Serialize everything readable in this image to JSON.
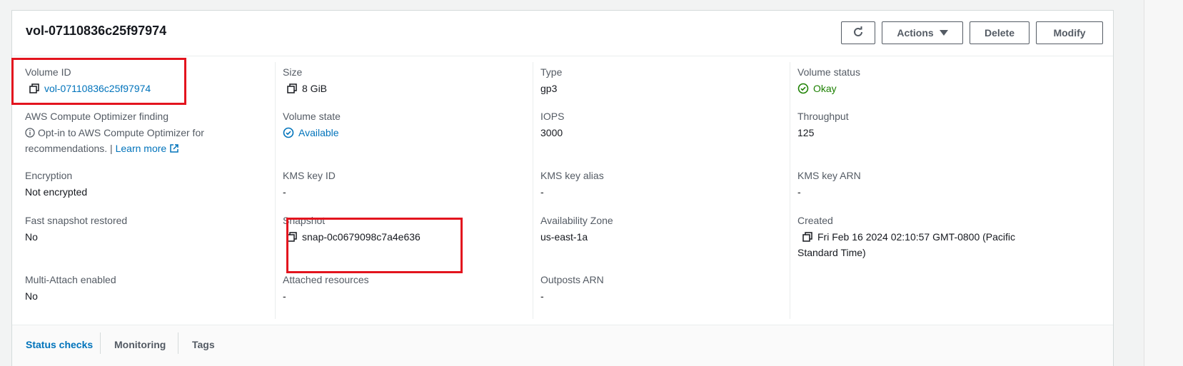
{
  "volume": {
    "title": "vol-07110836c25f97974"
  },
  "toolbar": {
    "actions_label": "Actions",
    "delete_label": "Delete",
    "modify_label": "Modify"
  },
  "fields": {
    "volume_id": {
      "label": "Volume ID",
      "value": "vol-07110836c25f97974"
    },
    "size": {
      "label": "Size",
      "value": "8 GiB"
    },
    "type": {
      "label": "Type",
      "value": "gp3"
    },
    "volume_status": {
      "label": "Volume status",
      "value": "Okay"
    },
    "optimizer": {
      "label": "AWS Compute Optimizer finding",
      "value": "Opt-in to AWS Compute Optimizer for recommendations. |",
      "link": "Learn more"
    },
    "volume_state": {
      "label": "Volume state",
      "value": "Available"
    },
    "iops": {
      "label": "IOPS",
      "value": "3000"
    },
    "throughput": {
      "label": "Throughput",
      "value": "125"
    },
    "encryption": {
      "label": "Encryption",
      "value": "Not encrypted"
    },
    "kms_key_id": {
      "label": "KMS key ID",
      "value": "-"
    },
    "kms_key_alias": {
      "label": "KMS key alias",
      "value": "-"
    },
    "kms_key_arn": {
      "label": "KMS key ARN",
      "value": "-"
    },
    "fast_snapshot": {
      "label": "Fast snapshot restored",
      "value": "No"
    },
    "snapshot": {
      "label": "Snapshot",
      "value": "snap-0c0679098c7a4e636"
    },
    "availability_zone": {
      "label": "Availability Zone",
      "value": "us-east-1a"
    },
    "created": {
      "label": "Created",
      "value": "Fri Feb 16 2024 02:10:57 GMT-0800 (Pacific Standard Time)"
    },
    "multi_attach": {
      "label": "Multi-Attach enabled",
      "value": "No"
    },
    "attached_resources": {
      "label": "Attached resources",
      "value": "-"
    },
    "outposts_arn": {
      "label": "Outposts ARN",
      "value": "-"
    }
  },
  "tabs": [
    {
      "label": "Status checks",
      "active": true
    },
    {
      "label": "Monitoring",
      "active": false
    },
    {
      "label": "Tags",
      "active": false
    }
  ],
  "colors": {
    "link": "#0073bb",
    "success": "#1d8102",
    "highlight": "#e3141e"
  },
  "icons": {
    "copy": "copy-icon",
    "refresh": "refresh-icon",
    "status_ok": "check-circle-icon",
    "info": "info-icon",
    "external": "external-link-icon"
  }
}
